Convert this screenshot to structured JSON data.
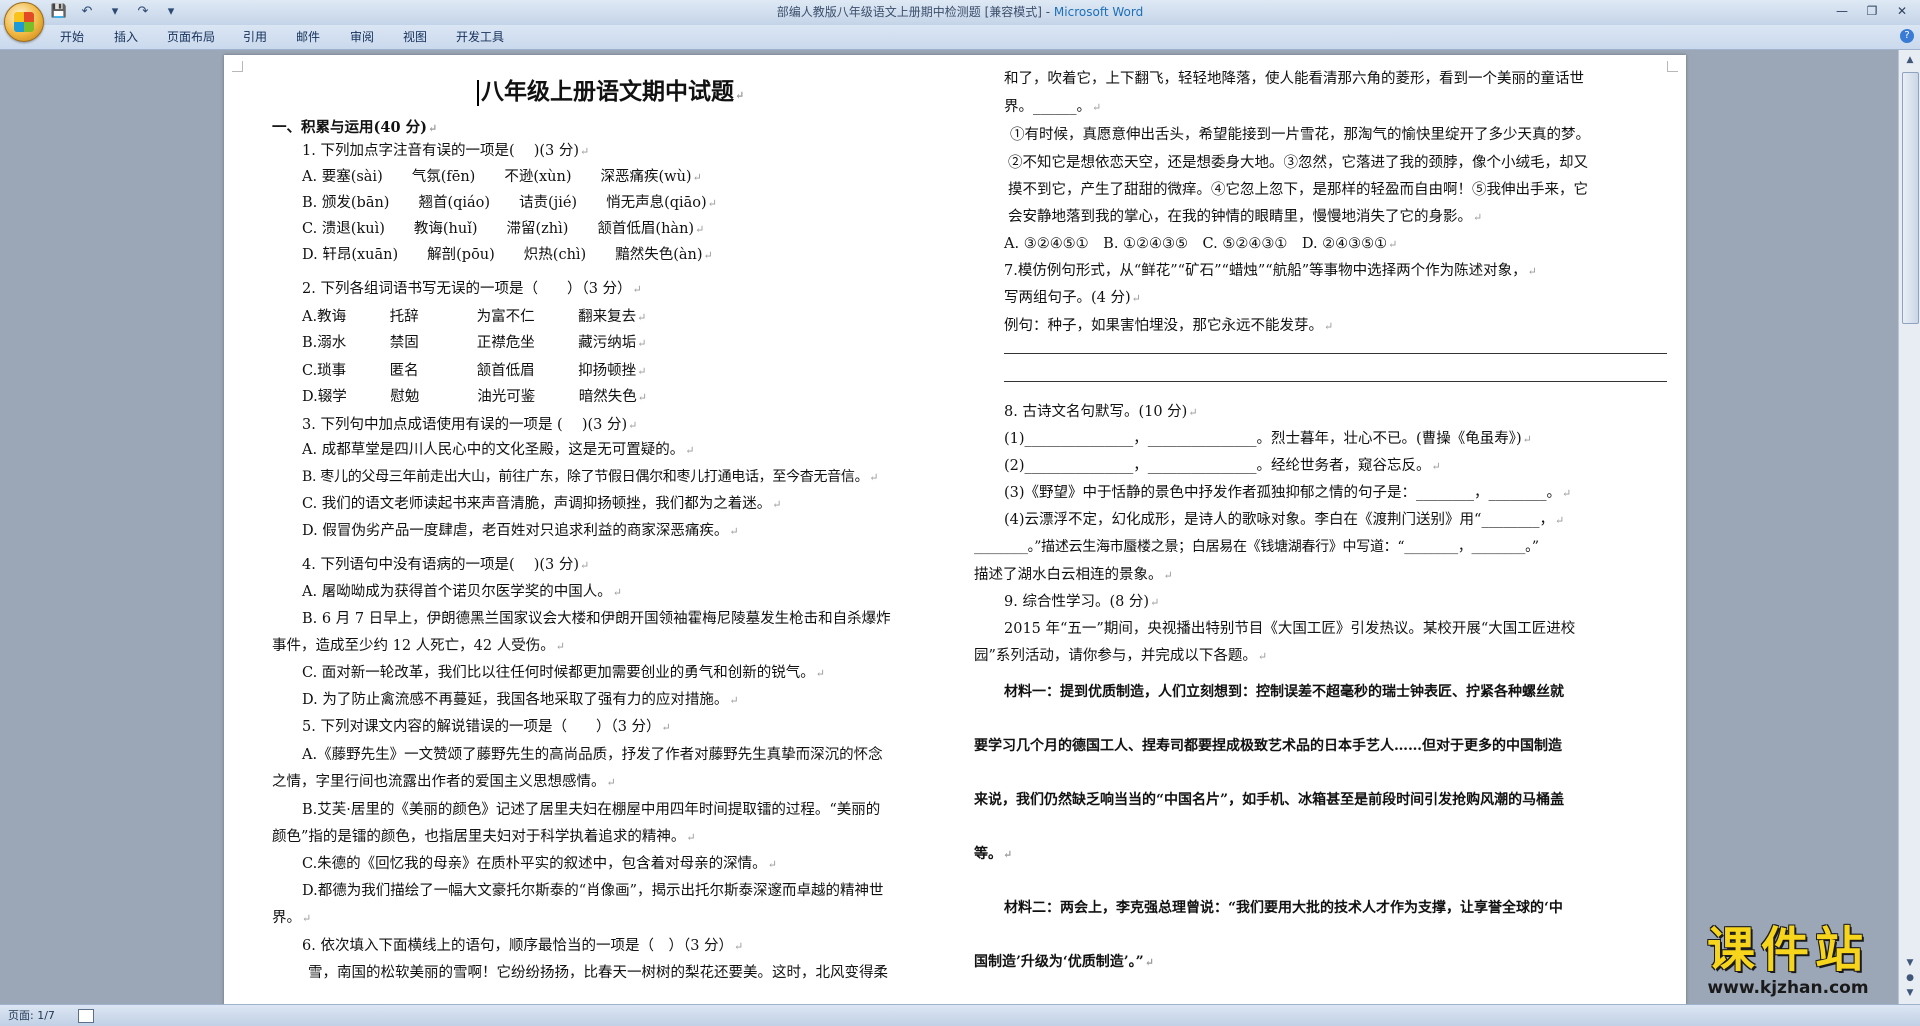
{
  "window": {
    "title_left": "部编人教版八年级语文上册期中检测题 [兼容模式] - ",
    "title_app": "Microsoft Word",
    "qat": [
      "💾",
      "↶",
      "▾",
      "↷",
      "▾"
    ],
    "controls": [
      "—",
      "❐",
      "✕"
    ]
  },
  "menu": {
    "tabs": [
      "开始",
      "插入",
      "页面布局",
      "引用",
      "邮件",
      "审阅",
      "视图",
      "开发工具"
    ],
    "help": "?"
  },
  "status": {
    "page": "页面: 1/7"
  },
  "doc": {
    "left": [
      "八年级上册语文期中试题",
      "一、积累与运用(40 分)",
      "1. 下列加点字注音有误的一项是(　 )(3 分)",
      "A. 要塞(sài)　　气氛(fēn)　　不逊(xùn)　　深恶痛疾(wù)",
      "B. 颁发(bān)　　翘首(qiáo)　　诘责(jié)　　悄无声息(qiāo)",
      "C. 溃退(kuì)　　教诲(huǐ)　　滞留(zhì)　　颔首低眉(hàn)",
      "D. 轩昂(xuān)　　解剖(pōu)　　炽热(chì)　　黯然失色(àn)",
      "2. 下列各组词语书写无误的一项是（　　）（3 分）",
      "A.教诲　　　托辞　　　　为富不仁　　　翻来复去",
      "B.溺水　　　禁固　　　　正襟危坐　　　藏污纳垢",
      "C.琐事　　　匿名　　　　颔首低眉　　　抑扬顿挫",
      "D.辍学　　　慰勉　　　　油光可鉴　　　暗然失色",
      "3. 下列句中加点成语使用有误的一项是 (　 )(3 分)",
      "A. 成都草堂是四川人民心中的文化圣殿，这是无可置疑的。",
      "B. 枣儿的父母三年前走出大山，前往广东，除了节假日偶尔和枣儿打通电话，至今杳无音信。",
      "C. 我们的语文老师读起书来声音清脆，声调抑扬顿挫，我们都为之着迷。",
      "D. 假冒伪劣产品一度肆虐，老百姓对只追求利益的商家深恶痛疾。",
      "4. 下列语句中没有语病的一项是(　 )(3 分)",
      "A. 屠呦呦成为获得首个诺贝尔医学奖的中国人。",
      "B. 6 月 7 日早上，伊朗德黑兰国家议会大楼和伊朗开国领袖霍梅尼陵墓发生枪击和自杀爆炸",
      "事件，造成至少约 12 人死亡，42 人受伤。",
      "C. 面对新一轮改革，我们比以往任何时候都更加需要创业的勇气和创新的锐气。",
      "D. 为了防止禽流感不再蔓延，我国各地采取了强有力的应对措施。",
      "5. 下列对课文内容的解说错误的一项是（　　）（3 分）",
      "A.《藤野先生》一文赞颂了藤野先生的高尚品质，抒发了作者对藤野先生真挚而深沉的怀念",
      "之情，字里行间也流露出作者的爱国主义思想感情。",
      "B.艾芙·居里的《美丽的颜色》记述了居里夫妇在棚屋中用四年时间提取镭的过程。“美丽的",
      "颜色”指的是镭的颜色，也指居里夫妇对于科学执着追求的精神。",
      "C.朱德的《回忆我的母亲》在质朴平实的叙述中，包含着对母亲的深情。",
      "D.都德为我们描绘了一幅大文豪托尔斯泰的“肖像画”，揭示出托尔斯泰深邃而卓越的精神世",
      "界。",
      "6. 依次填入下面横线上的语句，顺序最恰当的一项是（　）（3 分）",
      "雪，南国的松软美丽的雪啊！它纷纷扬扬，比春天一树树的梨花还要美。这时，北风变得柔"
    ],
    "right": [
      "和了，吹着它，上下翻飞，轻轻地降落，使人能看清那六角的菱形，看到一个美丽的童话世",
      "界。______。",
      "①有时候，真愿意伸出舌头，希望能接到一片雪花，那淘气的愉快里绽开了多少天真的梦。",
      "②不知它是想依恋天空，还是想委身大地。③忽然，它落进了我的颈脖，像个小绒毛，却又",
      "摸不到它，产生了甜甜的微痒。④它忽上忽下，是那样的轻盈而自由啊！⑤我伸出手来，它",
      "会安静地落到我的掌心，在我的钟情的眼睛里，慢慢地消失了它的身影。",
      "A. ③②④⑤①　B. ①②④③⑤　C. ⑤②④③①　D. ②④③⑤①",
      "7.模仿例句形式，从“鲜花”“矿石”“蜡烛”“航船”等事物中选择两个作为陈述对象，",
      "写两组句子。(4 分)",
      "例句：种子，如果害怕埋没，那它永远不能发芽。",
      "8. 古诗文名句默写。(10 分)",
      "(1)_______________，_______________。烈士暮年，壮心不已。(曹操《龟虽寿》)",
      "(2)_______________，_______________。经纶世务者，窥谷忘反。",
      "(3)《野望》中于恬静的景色中抒发作者孤独抑郁之情的句子是：________，________。",
      "(4)云漂浮不定，幻化成形，是诗人的歌咏对象。李白在《渡荆门送别》用“________，",
      "________。”描述云生海市蜃楼之景；白居易在《钱塘湖春行》中写道：“________，________。”",
      "描述了湖水白云相连的景象。",
      "9. 综合性学习。(8 分)",
      "2015 年“五一”期间，央视播出特别节目《大国工匠》引发热议。某校开展“大国工匠进校",
      "园”系列活动，请你参与，并完成以下各题。",
      "材料一：提到优质制造，人们立刻想到：控制误差不超毫秒的瑞士钟表匠、拧紧各种螺丝就",
      "要学习几个月的德国工人、捏寿司都要捏成极致艺术品的日本手艺人……但对于更多的中国制造",
      "来说，我们仍然缺乏响当当的“中国名片”，如手机、冰箱甚至是前段时间引发抢购风潮的马桶盖",
      "等。",
      "材料二：两会上，李克强总理曾说：“我们要用大批的技术人才作为支撑，让享誉全球的‘中",
      "国制造’升级为‘优质制造’。”"
    ]
  },
  "watermark": {
    "main": "课件站",
    "url": "www.kjzhan.com"
  }
}
